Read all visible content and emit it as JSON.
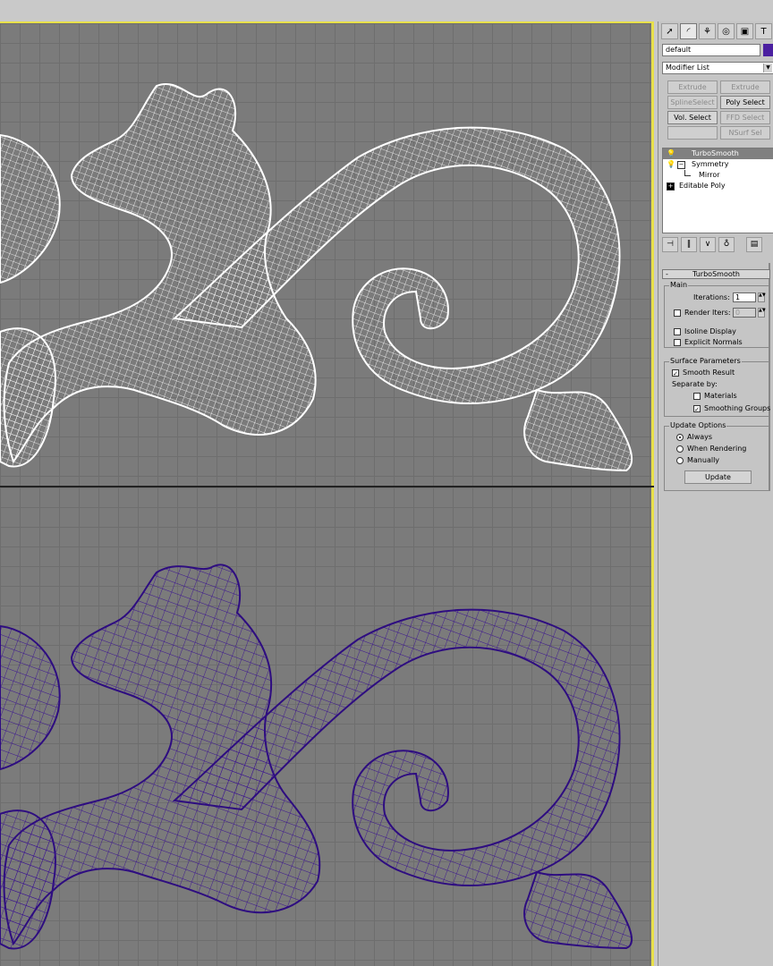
{
  "panel": {
    "toolbar": [
      "pointer-icon",
      "modify-icon",
      "hierarchy-icon",
      "motion-icon",
      "display-icon",
      "utilities-icon"
    ],
    "object_name": "default",
    "object_color": "#4a1fa0",
    "modifier_list": "Modifier List",
    "mod_buttons": [
      {
        "label": "Extrude",
        "enabled": false
      },
      {
        "label": "Extrude",
        "enabled": false
      },
      {
        "label": "SplineSelect",
        "enabled": false
      },
      {
        "label": "Poly Select",
        "enabled": true
      },
      {
        "label": "Vol. Select",
        "enabled": true
      },
      {
        "label": "FFD Select",
        "enabled": false
      },
      {
        "label": "",
        "enabled": false
      },
      {
        "label": "NSurf Sel",
        "enabled": false
      }
    ],
    "stack": [
      {
        "label": "TurboSmooth",
        "selected": true
      },
      {
        "label": "Symmetry",
        "selected": false
      },
      {
        "label": "Mirror",
        "selected": false
      },
      {
        "label": "Editable Poly",
        "selected": false
      }
    ],
    "rollout_title": "TurboSmooth",
    "main_group": "Main",
    "iterations_label": "Iterations:",
    "iterations_value": "1",
    "render_iters_label": "Render Iters:",
    "render_iters_value": "0",
    "isoline_display": "Isoline Display",
    "explicit_normals": "Explicit Normals",
    "surface_group": "Surface Parameters",
    "smooth_result": "Smooth Result",
    "separate_by": "Separate by:",
    "materials": "Materials",
    "smoothing_groups": "Smoothing Groups",
    "update_group": "Update Options",
    "always": "Always",
    "when_rendering": "When Rendering",
    "manually": "Manually",
    "update_button": "Update"
  },
  "colors": {
    "viewport_bg": "#7b7b7b",
    "active_border": "#e8e04a",
    "top_wire": "#ffffff",
    "bottom_wire": "#3a1290"
  }
}
